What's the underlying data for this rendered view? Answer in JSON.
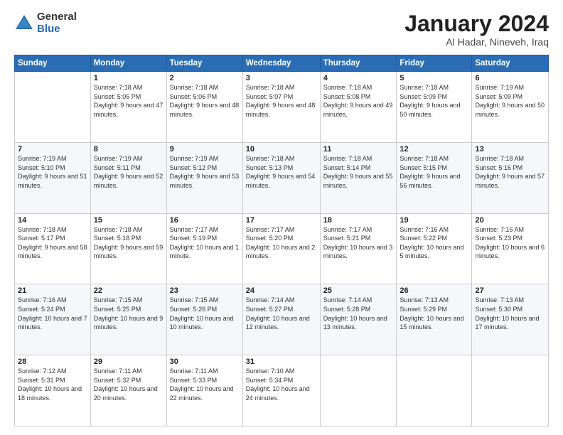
{
  "logo": {
    "general": "General",
    "blue": "Blue"
  },
  "title": {
    "month": "January 2024",
    "location": "Al Hadar, Nineveh, Iraq"
  },
  "calendar": {
    "headers": [
      "Sunday",
      "Monday",
      "Tuesday",
      "Wednesday",
      "Thursday",
      "Friday",
      "Saturday"
    ],
    "weeks": [
      [
        {
          "day": "",
          "sunrise": "",
          "sunset": "",
          "daylight": ""
        },
        {
          "day": "1",
          "sunrise": "Sunrise: 7:18 AM",
          "sunset": "Sunset: 5:05 PM",
          "daylight": "Daylight: 9 hours and 47 minutes."
        },
        {
          "day": "2",
          "sunrise": "Sunrise: 7:18 AM",
          "sunset": "Sunset: 5:06 PM",
          "daylight": "Daylight: 9 hours and 48 minutes."
        },
        {
          "day": "3",
          "sunrise": "Sunrise: 7:18 AM",
          "sunset": "Sunset: 5:07 PM",
          "daylight": "Daylight: 9 hours and 48 minutes."
        },
        {
          "day": "4",
          "sunrise": "Sunrise: 7:18 AM",
          "sunset": "Sunset: 5:08 PM",
          "daylight": "Daylight: 9 hours and 49 minutes."
        },
        {
          "day": "5",
          "sunrise": "Sunrise: 7:18 AM",
          "sunset": "Sunset: 5:09 PM",
          "daylight": "Daylight: 9 hours and 50 minutes."
        },
        {
          "day": "6",
          "sunrise": "Sunrise: 7:19 AM",
          "sunset": "Sunset: 5:09 PM",
          "daylight": "Daylight: 9 hours and 50 minutes."
        }
      ],
      [
        {
          "day": "7",
          "sunrise": "Sunrise: 7:19 AM",
          "sunset": "Sunset: 5:10 PM",
          "daylight": "Daylight: 9 hours and 51 minutes."
        },
        {
          "day": "8",
          "sunrise": "Sunrise: 7:19 AM",
          "sunset": "Sunset: 5:11 PM",
          "daylight": "Daylight: 9 hours and 52 minutes."
        },
        {
          "day": "9",
          "sunrise": "Sunrise: 7:19 AM",
          "sunset": "Sunset: 5:12 PM",
          "daylight": "Daylight: 9 hours and 53 minutes."
        },
        {
          "day": "10",
          "sunrise": "Sunrise: 7:18 AM",
          "sunset": "Sunset: 5:13 PM",
          "daylight": "Daylight: 9 hours and 54 minutes."
        },
        {
          "day": "11",
          "sunrise": "Sunrise: 7:18 AM",
          "sunset": "Sunset: 5:14 PM",
          "daylight": "Daylight: 9 hours and 55 minutes."
        },
        {
          "day": "12",
          "sunrise": "Sunrise: 7:18 AM",
          "sunset": "Sunset: 5:15 PM",
          "daylight": "Daylight: 9 hours and 56 minutes."
        },
        {
          "day": "13",
          "sunrise": "Sunrise: 7:18 AM",
          "sunset": "Sunset: 5:16 PM",
          "daylight": "Daylight: 9 hours and 57 minutes."
        }
      ],
      [
        {
          "day": "14",
          "sunrise": "Sunrise: 7:18 AM",
          "sunset": "Sunset: 5:17 PM",
          "daylight": "Daylight: 9 hours and 58 minutes."
        },
        {
          "day": "15",
          "sunrise": "Sunrise: 7:18 AM",
          "sunset": "Sunset: 5:18 PM",
          "daylight": "Daylight: 9 hours and 59 minutes."
        },
        {
          "day": "16",
          "sunrise": "Sunrise: 7:17 AM",
          "sunset": "Sunset: 5:19 PM",
          "daylight": "Daylight: 10 hours and 1 minute."
        },
        {
          "day": "17",
          "sunrise": "Sunrise: 7:17 AM",
          "sunset": "Sunset: 5:20 PM",
          "daylight": "Daylight: 10 hours and 2 minutes."
        },
        {
          "day": "18",
          "sunrise": "Sunrise: 7:17 AM",
          "sunset": "Sunset: 5:21 PM",
          "daylight": "Daylight: 10 hours and 3 minutes."
        },
        {
          "day": "19",
          "sunrise": "Sunrise: 7:16 AM",
          "sunset": "Sunset: 5:22 PM",
          "daylight": "Daylight: 10 hours and 5 minutes."
        },
        {
          "day": "20",
          "sunrise": "Sunrise: 7:16 AM",
          "sunset": "Sunset: 5:23 PM",
          "daylight": "Daylight: 10 hours and 6 minutes."
        }
      ],
      [
        {
          "day": "21",
          "sunrise": "Sunrise: 7:16 AM",
          "sunset": "Sunset: 5:24 PM",
          "daylight": "Daylight: 10 hours and 7 minutes."
        },
        {
          "day": "22",
          "sunrise": "Sunrise: 7:15 AM",
          "sunset": "Sunset: 5:25 PM",
          "daylight": "Daylight: 10 hours and 9 minutes."
        },
        {
          "day": "23",
          "sunrise": "Sunrise: 7:15 AM",
          "sunset": "Sunset: 5:26 PM",
          "daylight": "Daylight: 10 hours and 10 minutes."
        },
        {
          "day": "24",
          "sunrise": "Sunrise: 7:14 AM",
          "sunset": "Sunset: 5:27 PM",
          "daylight": "Daylight: 10 hours and 12 minutes."
        },
        {
          "day": "25",
          "sunrise": "Sunrise: 7:14 AM",
          "sunset": "Sunset: 5:28 PM",
          "daylight": "Daylight: 10 hours and 13 minutes."
        },
        {
          "day": "26",
          "sunrise": "Sunrise: 7:13 AM",
          "sunset": "Sunset: 5:29 PM",
          "daylight": "Daylight: 10 hours and 15 minutes."
        },
        {
          "day": "27",
          "sunrise": "Sunrise: 7:13 AM",
          "sunset": "Sunset: 5:30 PM",
          "daylight": "Daylight: 10 hours and 17 minutes."
        }
      ],
      [
        {
          "day": "28",
          "sunrise": "Sunrise: 7:12 AM",
          "sunset": "Sunset: 5:31 PM",
          "daylight": "Daylight: 10 hours and 18 minutes."
        },
        {
          "day": "29",
          "sunrise": "Sunrise: 7:11 AM",
          "sunset": "Sunset: 5:32 PM",
          "daylight": "Daylight: 10 hours and 20 minutes."
        },
        {
          "day": "30",
          "sunrise": "Sunrise: 7:11 AM",
          "sunset": "Sunset: 5:33 PM",
          "daylight": "Daylight: 10 hours and 22 minutes."
        },
        {
          "day": "31",
          "sunrise": "Sunrise: 7:10 AM",
          "sunset": "Sunset: 5:34 PM",
          "daylight": "Daylight: 10 hours and 24 minutes."
        },
        {
          "day": "",
          "sunrise": "",
          "sunset": "",
          "daylight": ""
        },
        {
          "day": "",
          "sunrise": "",
          "sunset": "",
          "daylight": ""
        },
        {
          "day": "",
          "sunrise": "",
          "sunset": "",
          "daylight": ""
        }
      ]
    ]
  }
}
